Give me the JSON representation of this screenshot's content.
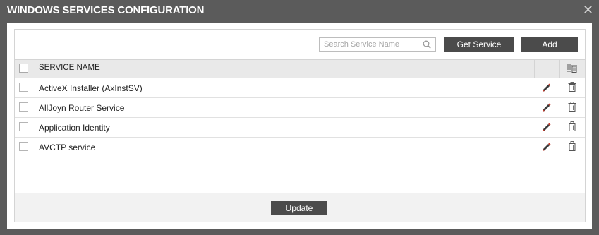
{
  "dialog": {
    "title": "WINDOWS SERVICES CONFIGURATION",
    "close_icon": "close-icon"
  },
  "toolbar": {
    "search_placeholder": "Search Service Name",
    "search_value": "",
    "get_service_label": "Get Service",
    "add_label": "Add"
  },
  "table": {
    "header": {
      "name": "SERVICE NAME"
    },
    "rows": [
      {
        "name": "ActiveX Installer (AxInstSV)"
      },
      {
        "name": "AllJoyn Router Service"
      },
      {
        "name": "Application Identity"
      },
      {
        "name": "AVCTP service"
      }
    ]
  },
  "footer": {
    "update_label": "Update"
  },
  "colors": {
    "button_bg": "#4b4b4b",
    "header_bg": "#e9e9e9",
    "edit_pencil": "#c0392b"
  }
}
